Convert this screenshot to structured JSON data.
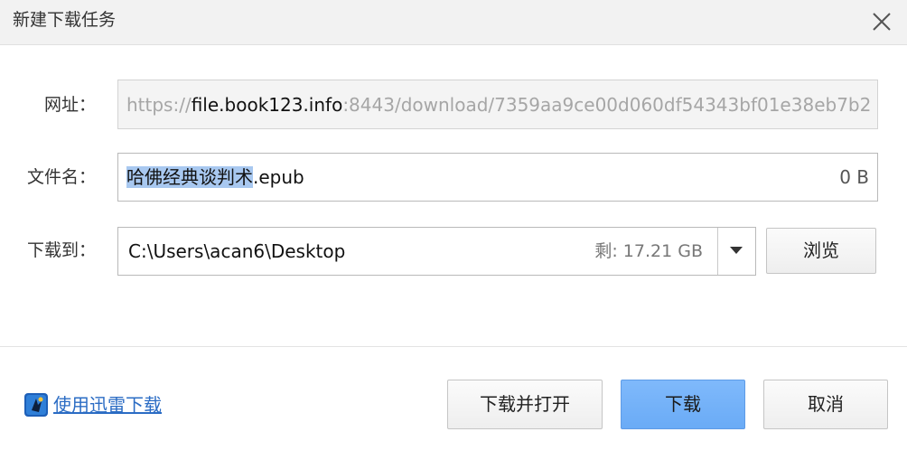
{
  "window": {
    "title": "新建下载任务",
    "close_icon": "close-icon"
  },
  "form": {
    "url_label": "网址：",
    "url_prefix": "https://",
    "url_host": "file.book123.info",
    "url_rest": ":8443/download/7359aa9ce00d060df54343bf01e38eb7b2",
    "filename_label": "文件名：",
    "filename_selected": "哈佛经典谈判术",
    "filename_ext": ".epub",
    "file_size": "0 B",
    "saveto_label": "下载到：",
    "save_path": "C:\\Users\\acan6\\Desktop",
    "free_space": "剩: 17.21 GB",
    "dropdown_icon": "chevron-down-icon",
    "browse_label": "浏览"
  },
  "footer": {
    "thunder_icon": "thunder-app-icon",
    "thunder_label": "使用迅雷下载",
    "download_open_label": "下载并打开",
    "download_label": "下载",
    "cancel_label": "取消"
  },
  "colors": {
    "accent": "#6aabf6",
    "link": "#2b6cc4",
    "selection": "#a8c8f0"
  }
}
